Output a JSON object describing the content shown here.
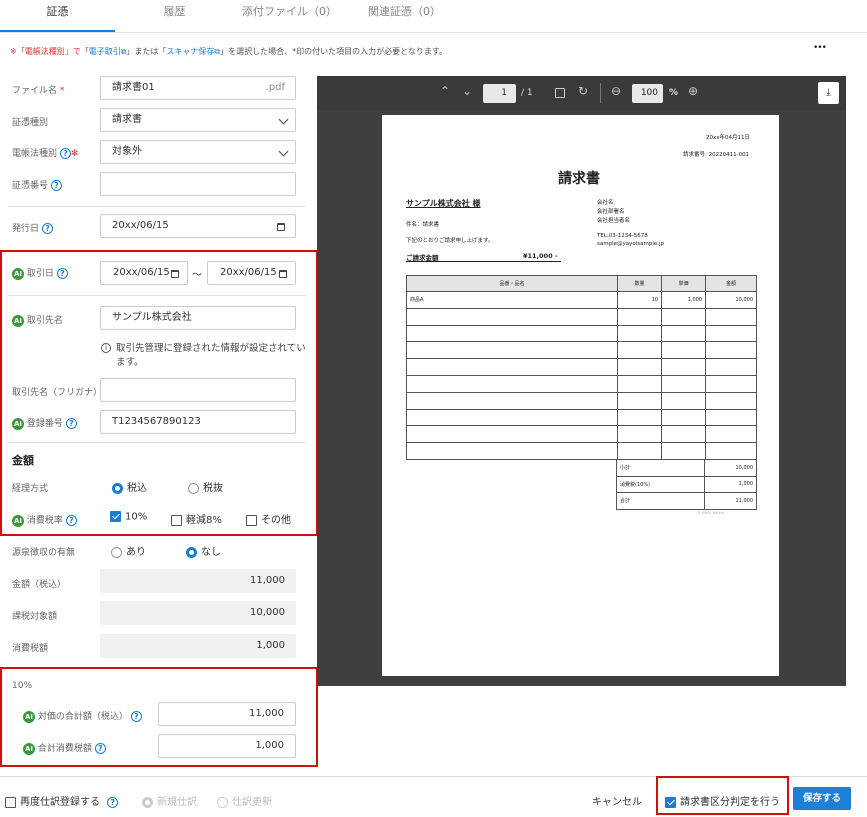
{
  "tabs": [
    "証憑",
    "履歴",
    "添付ファイル（0）",
    "関連証憑（0）"
  ],
  "notice": {
    "prefix": "※「電帳法種別」で「",
    "link1": "電子取引",
    "mid": "」または「",
    "link2": "スキャナ保存",
    "suffix": "」を選択した場合、*印の付いた項目の入力が必要となります。"
  },
  "more": "•••",
  "form": {
    "file_name_label": "ファイル名",
    "required_mark": "*",
    "file_name_value": "請求書01",
    "file_ext": ".pdf",
    "doc_type_label": "証憑種別",
    "doc_type_value": "請求書",
    "ebook_type_label": "電帳法種別",
    "ebook_type_value": "対象外",
    "doc_number_label": "証憑番号",
    "doc_number_value": "",
    "issue_date_label": "発行日",
    "issue_date_value": "20xx/06/15",
    "trade_date_label": "取引日",
    "trade_date_from": "20xx/06/15",
    "tilde": "〜",
    "trade_date_to": "20xx/06/15",
    "partner_label": "取引先名",
    "partner_value": "サンプル株式会社",
    "partner_info": "取引先管理に登録された情報が設定されています。",
    "partner_kana_label": "取引先名（フリガナ）",
    "partner_kana_value": "",
    "reg_no_label": "登録番号",
    "reg_no_value": "T1234567890123",
    "amount_heading": "金額",
    "tax_method_label": "経理方式",
    "tax_incl": "税込",
    "tax_excl": "税抜",
    "tax_rate_label": "消費税率",
    "rate_10": "10%",
    "rate_reduced": "軽減8%",
    "rate_other": "その他",
    "withholding_label": "源泉徴収の有無",
    "wh_yes": "あり",
    "wh_no": "なし",
    "amount_incl_label": "金額（税込）",
    "amount_incl": "11,000",
    "taxable_label": "課税対象額",
    "taxable": "10,000",
    "tax_label": "消費税額",
    "tax": "1,000",
    "rate_section": "10%",
    "total_incl_label": "対価の合計額（税込）",
    "total_incl": "11,000",
    "total_tax_label": "合計消費税額",
    "total_tax": "1,000"
  },
  "ai_badge": "AI",
  "viewer": {
    "page": "1",
    "page_total": "/ 1",
    "zoom": "100",
    "zoom_unit": "%"
  },
  "invoice": {
    "date": "20xx年04月11日",
    "number": "請求番号: 20220411-001",
    "title": "請求書",
    "to": "サンプル株式会社 様",
    "subject": "件名：請求書",
    "body": "下記のとおりご請求申し上げます。",
    "total_label": "ご請求金額",
    "total_value": "¥11,000 -",
    "company_lines": [
      "会社名",
      "会社部署名",
      "会社担当者名"
    ],
    "contact_lines": [
      "TEL:03-1234-5678",
      "sample@yayoisample.jp"
    ],
    "headers": [
      "品番・品名",
      "数量",
      "単価",
      "金額"
    ],
    "first_row": [
      "商品A",
      "10",
      "1,000",
      "10,000"
    ],
    "totals": [
      [
        "小計",
        "10,000"
      ],
      [
        "消費税(10%)",
        "1,000"
      ],
      [
        "合計",
        "11,000"
      ]
    ],
    "footer": "© YAYOI ※※※※"
  },
  "footer": {
    "reregister": "再度仕訳登録する",
    "new_entry": "新規仕訳",
    "update_entry": "仕訳更新",
    "cancel": "キャンセル",
    "invoice_check": "請求書区分判定を行う",
    "save": "保存する"
  }
}
